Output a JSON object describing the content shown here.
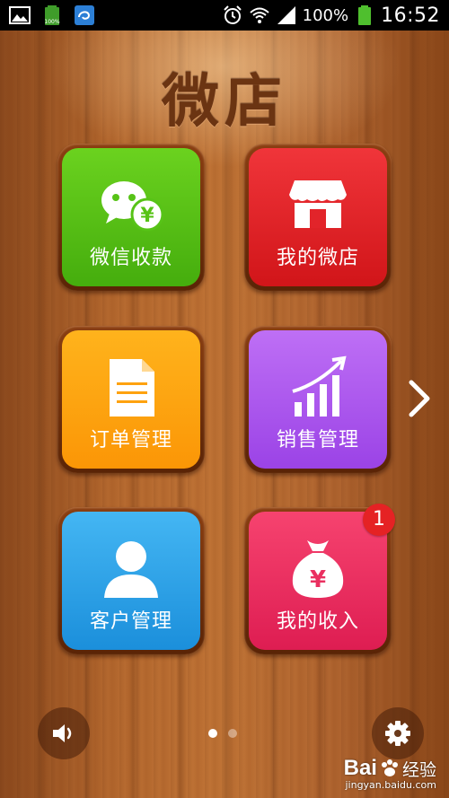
{
  "status_bar": {
    "battery_text": "100%",
    "time": "16:52",
    "left_icons": [
      "image-icon",
      "battery-saver-icon",
      "app-icon"
    ],
    "right_icons": [
      "alarm-icon",
      "wifi-icon",
      "signal-icon",
      "battery-icon"
    ]
  },
  "app": {
    "title": "微店"
  },
  "tiles": [
    {
      "label": "微信收款",
      "icon": "wechat-payment-icon",
      "color": "#57c317"
    },
    {
      "label": "我的微店",
      "icon": "store-icon",
      "color": "#e2242a"
    },
    {
      "label": "订单管理",
      "icon": "document-icon",
      "color": "#fea20f"
    },
    {
      "label": "销售管理",
      "icon": "sales-chart-icon",
      "color": "#ab58ee"
    },
    {
      "label": "客户管理",
      "icon": "customer-icon",
      "color": "#2fa2e7"
    },
    {
      "label": "我的收入",
      "icon": "money-bag-icon",
      "color": "#ea3060",
      "badge": "1"
    }
  ],
  "pager": {
    "pages": 2,
    "current": 1
  },
  "watermark": {
    "brand": "Bai",
    "brand_cn": "经验",
    "url": "jingyan.baidu.com"
  }
}
